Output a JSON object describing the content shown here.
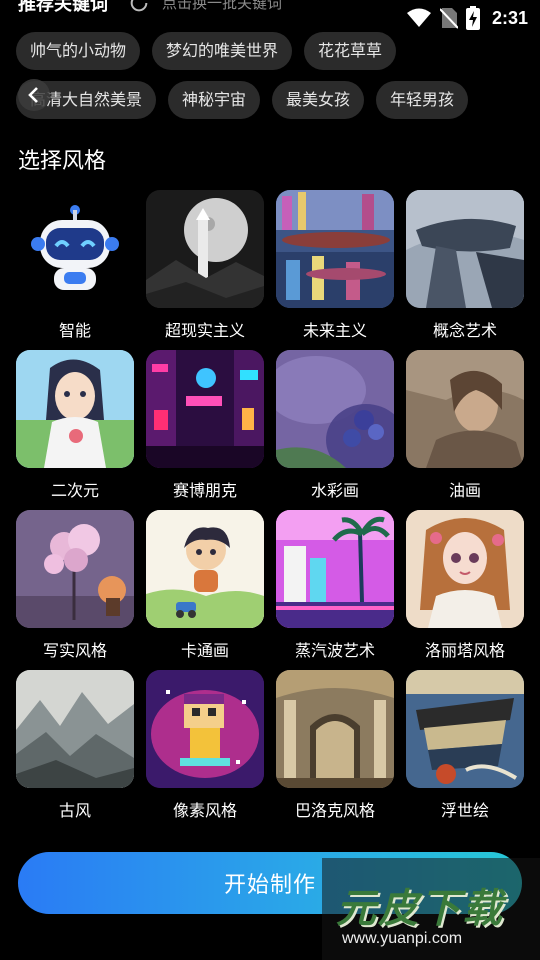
{
  "header": {
    "title": "推荐关键词",
    "refresh_text": "点击换一批关键词"
  },
  "status": {
    "time": "2:31"
  },
  "keywords_row1": [
    "帅气的小动物",
    "梦幻的唯美世界",
    "花花草草"
  ],
  "keywords_row2": [
    "高清大自然美景",
    "神秘宇宙",
    "最美女孩",
    "年轻男孩"
  ],
  "section_title": "选择风格",
  "styles": [
    {
      "label": "智能"
    },
    {
      "label": "超现实主义"
    },
    {
      "label": "未来主义"
    },
    {
      "label": "概念艺术"
    },
    {
      "label": "二次元"
    },
    {
      "label": "赛博朋克"
    },
    {
      "label": "水彩画"
    },
    {
      "label": "油画"
    },
    {
      "label": "写实风格"
    },
    {
      "label": "卡通画"
    },
    {
      "label": "蒸汽波艺术"
    },
    {
      "label": "洛丽塔风格"
    },
    {
      "label": "古风"
    },
    {
      "label": "像素风格"
    },
    {
      "label": "巴洛克风格"
    },
    {
      "label": "浮世绘"
    }
  ],
  "start_button": "开始制作",
  "watermark": {
    "logo": "元皮下载",
    "url": "www.yuanpi.com"
  },
  "colors": {
    "accent_start": "#2a7bf5",
    "accent_end": "#27c9d6",
    "chip_bg": "#2b2b2b"
  }
}
